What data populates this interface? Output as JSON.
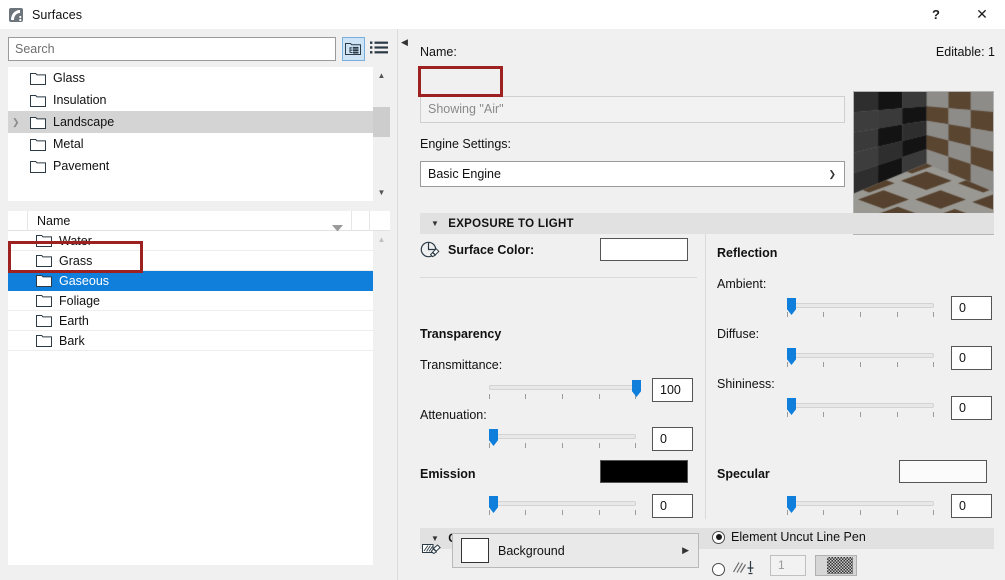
{
  "window": {
    "title": "Surfaces",
    "app_icon": "archicad-surface-icon",
    "help_label": "?",
    "close_label": "✕"
  },
  "left": {
    "search": {
      "placeholder": "Search",
      "value": ""
    },
    "view_toggles": [
      {
        "name": "tree-view-toggle",
        "icon": "tree-view-icon",
        "active": true
      },
      {
        "name": "list-view-toggle",
        "icon": "list-view-icon",
        "active": false
      }
    ],
    "tree_items": [
      {
        "label": "Glass",
        "expandable": false,
        "selected": false
      },
      {
        "label": "Insulation",
        "expandable": false,
        "selected": false
      },
      {
        "label": "Landscape",
        "expandable": true,
        "selected": true
      },
      {
        "label": "Metal",
        "expandable": false,
        "selected": false
      },
      {
        "label": "Pavement",
        "expandable": false,
        "selected": false
      }
    ],
    "table": {
      "column_header": "Name",
      "rows": [
        {
          "label": "Water",
          "selected": false
        },
        {
          "label": "Grass",
          "selected": false
        },
        {
          "label": "Gaseous",
          "selected": true
        },
        {
          "label": "Foliage",
          "selected": false
        },
        {
          "label": "Earth",
          "selected": false
        },
        {
          "label": "Bark",
          "selected": false
        }
      ]
    }
  },
  "right": {
    "name_label": "Name:",
    "editable_label": "Editable: 1",
    "name_value": "Showing \"Air\"",
    "engine_label": "Engine Settings:",
    "engine_value": "Basic Engine",
    "preview": {
      "name": "material-preview"
    },
    "exposure": {
      "header": "EXPOSURE TO LIGHT",
      "surface_color_label": "Surface Color:",
      "surface_color_value": "#ffffff",
      "transparency_group": "Transparency",
      "transmittance_label": "Transmittance:",
      "transmittance_value": "100",
      "attenuation_label": "Attenuation:",
      "attenuation_value": "0",
      "emission_label": "Emission",
      "emission_color": "#000000",
      "emission_value": "0",
      "reflection_group": "Reflection",
      "ambient_label": "Ambient:",
      "ambient_value": "0",
      "diffuse_label": "Diffuse:",
      "diffuse_value": "0",
      "shininess_label": "Shininess:",
      "shininess_value": "0",
      "specular_label": "Specular",
      "specular_color": "#fbfbfb",
      "specular_value": "0"
    },
    "cover_fill": {
      "header": "COVER FILL FOREGROUND",
      "background_label": "Background",
      "background_color": "#ffffff",
      "uncut_pen_label": "Element Uncut Line Pen",
      "pen_number": "1"
    }
  },
  "colors": {
    "selection_blue": "#0f7fdb",
    "highlight_red": "#9e2122",
    "panel_bg": "#f0f0f0",
    "section_hdr": "#e1e1e1"
  }
}
